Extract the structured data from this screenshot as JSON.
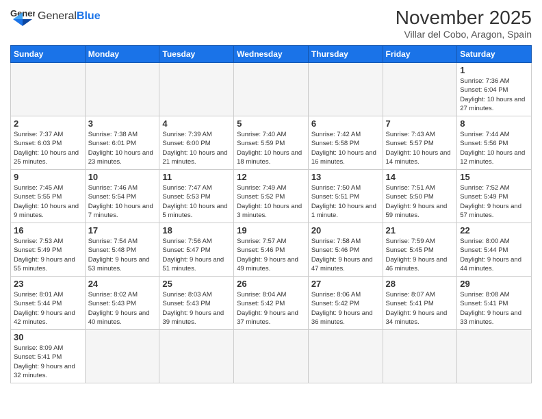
{
  "header": {
    "logo_general": "General",
    "logo_blue": "Blue",
    "month_title": "November 2025",
    "location": "Villar del Cobo, Aragon, Spain"
  },
  "weekdays": [
    "Sunday",
    "Monday",
    "Tuesday",
    "Wednesday",
    "Thursday",
    "Friday",
    "Saturday"
  ],
  "weeks": [
    [
      {
        "day": "",
        "info": ""
      },
      {
        "day": "",
        "info": ""
      },
      {
        "day": "",
        "info": ""
      },
      {
        "day": "",
        "info": ""
      },
      {
        "day": "",
        "info": ""
      },
      {
        "day": "",
        "info": ""
      },
      {
        "day": "1",
        "info": "Sunrise: 7:36 AM\nSunset: 6:04 PM\nDaylight: 10 hours and 27 minutes."
      }
    ],
    [
      {
        "day": "2",
        "info": "Sunrise: 7:37 AM\nSunset: 6:03 PM\nDaylight: 10 hours and 25 minutes."
      },
      {
        "day": "3",
        "info": "Sunrise: 7:38 AM\nSunset: 6:01 PM\nDaylight: 10 hours and 23 minutes."
      },
      {
        "day": "4",
        "info": "Sunrise: 7:39 AM\nSunset: 6:00 PM\nDaylight: 10 hours and 21 minutes."
      },
      {
        "day": "5",
        "info": "Sunrise: 7:40 AM\nSunset: 5:59 PM\nDaylight: 10 hours and 18 minutes."
      },
      {
        "day": "6",
        "info": "Sunrise: 7:42 AM\nSunset: 5:58 PM\nDaylight: 10 hours and 16 minutes."
      },
      {
        "day": "7",
        "info": "Sunrise: 7:43 AM\nSunset: 5:57 PM\nDaylight: 10 hours and 14 minutes."
      },
      {
        "day": "8",
        "info": "Sunrise: 7:44 AM\nSunset: 5:56 PM\nDaylight: 10 hours and 12 minutes."
      }
    ],
    [
      {
        "day": "9",
        "info": "Sunrise: 7:45 AM\nSunset: 5:55 PM\nDaylight: 10 hours and 9 minutes."
      },
      {
        "day": "10",
        "info": "Sunrise: 7:46 AM\nSunset: 5:54 PM\nDaylight: 10 hours and 7 minutes."
      },
      {
        "day": "11",
        "info": "Sunrise: 7:47 AM\nSunset: 5:53 PM\nDaylight: 10 hours and 5 minutes."
      },
      {
        "day": "12",
        "info": "Sunrise: 7:49 AM\nSunset: 5:52 PM\nDaylight: 10 hours and 3 minutes."
      },
      {
        "day": "13",
        "info": "Sunrise: 7:50 AM\nSunset: 5:51 PM\nDaylight: 10 hours and 1 minute."
      },
      {
        "day": "14",
        "info": "Sunrise: 7:51 AM\nSunset: 5:50 PM\nDaylight: 9 hours and 59 minutes."
      },
      {
        "day": "15",
        "info": "Sunrise: 7:52 AM\nSunset: 5:49 PM\nDaylight: 9 hours and 57 minutes."
      }
    ],
    [
      {
        "day": "16",
        "info": "Sunrise: 7:53 AM\nSunset: 5:49 PM\nDaylight: 9 hours and 55 minutes."
      },
      {
        "day": "17",
        "info": "Sunrise: 7:54 AM\nSunset: 5:48 PM\nDaylight: 9 hours and 53 minutes."
      },
      {
        "day": "18",
        "info": "Sunrise: 7:56 AM\nSunset: 5:47 PM\nDaylight: 9 hours and 51 minutes."
      },
      {
        "day": "19",
        "info": "Sunrise: 7:57 AM\nSunset: 5:46 PM\nDaylight: 9 hours and 49 minutes."
      },
      {
        "day": "20",
        "info": "Sunrise: 7:58 AM\nSunset: 5:46 PM\nDaylight: 9 hours and 47 minutes."
      },
      {
        "day": "21",
        "info": "Sunrise: 7:59 AM\nSunset: 5:45 PM\nDaylight: 9 hours and 46 minutes."
      },
      {
        "day": "22",
        "info": "Sunrise: 8:00 AM\nSunset: 5:44 PM\nDaylight: 9 hours and 44 minutes."
      }
    ],
    [
      {
        "day": "23",
        "info": "Sunrise: 8:01 AM\nSunset: 5:44 PM\nDaylight: 9 hours and 42 minutes."
      },
      {
        "day": "24",
        "info": "Sunrise: 8:02 AM\nSunset: 5:43 PM\nDaylight: 9 hours and 40 minutes."
      },
      {
        "day": "25",
        "info": "Sunrise: 8:03 AM\nSunset: 5:43 PM\nDaylight: 9 hours and 39 minutes."
      },
      {
        "day": "26",
        "info": "Sunrise: 8:04 AM\nSunset: 5:42 PM\nDaylight: 9 hours and 37 minutes."
      },
      {
        "day": "27",
        "info": "Sunrise: 8:06 AM\nSunset: 5:42 PM\nDaylight: 9 hours and 36 minutes."
      },
      {
        "day": "28",
        "info": "Sunrise: 8:07 AM\nSunset: 5:41 PM\nDaylight: 9 hours and 34 minutes."
      },
      {
        "day": "29",
        "info": "Sunrise: 8:08 AM\nSunset: 5:41 PM\nDaylight: 9 hours and 33 minutes."
      }
    ],
    [
      {
        "day": "30",
        "info": "Sunrise: 8:09 AM\nSunset: 5:41 PM\nDaylight: 9 hours and 32 minutes."
      },
      {
        "day": "",
        "info": ""
      },
      {
        "day": "",
        "info": ""
      },
      {
        "day": "",
        "info": ""
      },
      {
        "day": "",
        "info": ""
      },
      {
        "day": "",
        "info": ""
      },
      {
        "day": "",
        "info": ""
      }
    ]
  ]
}
